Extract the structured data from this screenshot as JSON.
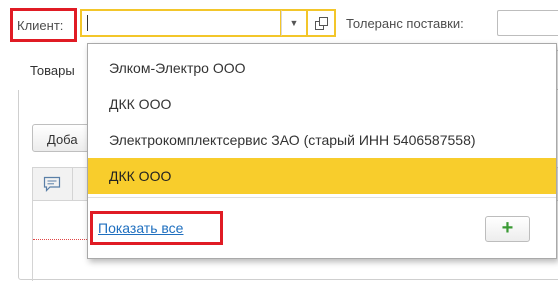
{
  "header": {
    "client_label": "Клиент:",
    "client_value": "",
    "tolerance_label": "Толеранс поставки:"
  },
  "panel": {
    "tab_label": "Товары",
    "add_button_label": "Доба"
  },
  "dropdown": {
    "items": [
      {
        "label": "Элком-Электро ООО"
      },
      {
        "label": "ДКК ООО"
      },
      {
        "label": "Электрокомплектсервис ЗАО (старый ИНН 5406587558)"
      },
      {
        "label": "ДКК ООО",
        "selected": true
      }
    ],
    "show_all_label": "Показать все",
    "add_button_symbol": "+"
  },
  "icons": {
    "dropdown_arrow": "chevron-down-icon",
    "open_form": "open-in-window-icon",
    "comment": "comment-icon",
    "add": "plus-icon"
  },
  "colors": {
    "selection": "#f8cd2c",
    "focus_border": "#f3c62a",
    "link": "#1f6fbf",
    "highlight_frame": "#e01b24",
    "add_icon": "#3a9a34"
  }
}
